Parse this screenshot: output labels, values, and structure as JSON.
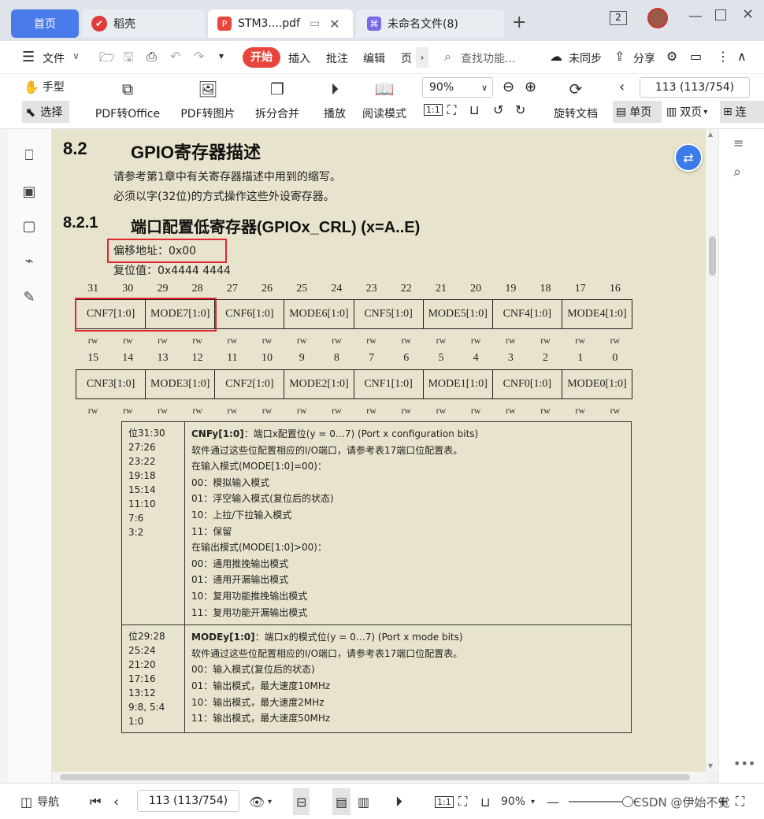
{
  "tabs": [
    {
      "label": "首页"
    },
    {
      "label": "稻壳"
    },
    {
      "label": "STM3....pdf"
    },
    {
      "label": "未命名文件(8)"
    }
  ],
  "window": {
    "badge": "2"
  },
  "menu": {
    "file": "文件",
    "start": "开始",
    "insert": "插入",
    "annotate": "批注",
    "edit": "编辑",
    "page": "页",
    "search_placeholder": "查找功能...",
    "unsynced": "未同步",
    "share": "分享"
  },
  "toolbar": {
    "hand": "手型",
    "select": "选择",
    "pdf_to_office": "PDF转Office",
    "pdf_to_image": "PDF转图片",
    "split_merge": "拆分合并",
    "play": "播放",
    "read_mode": "阅读模式",
    "zoom": "90%",
    "rotate_doc": "旋转文档",
    "page_indicator": "113 (113/754)",
    "single_page": "单页",
    "double_page": "双页",
    "continuous": "连"
  },
  "doc": {
    "section_num": "8.2",
    "section_title": "GPIO寄存器描述",
    "intro1": "请参考第1章中有关寄存器描述中用到的缩写。",
    "intro2": "必须以字(32位)的方式操作这些外设寄存器。",
    "sub_num": "8.2.1",
    "sub_title": "端口配置低寄存器(GPIOx_CRL) (x=A..E)",
    "offset": "偏移地址：0x00",
    "reset": "复位值：0x4444 4444",
    "bits_high": [
      "31",
      "30",
      "29",
      "28",
      "27",
      "26",
      "25",
      "24",
      "23",
      "22",
      "21",
      "20",
      "19",
      "18",
      "17",
      "16"
    ],
    "fields_high": [
      "CNF7[1:0]",
      "MODE7[1:0]",
      "CNF6[1:0]",
      "MODE6[1:0]",
      "CNF5[1:0]",
      "MODE5[1:0]",
      "CNF4[1:0]",
      "MODE4[1:0]"
    ],
    "bits_low": [
      "15",
      "14",
      "13",
      "12",
      "11",
      "10",
      "9",
      "8",
      "7",
      "6",
      "5",
      "4",
      "3",
      "2",
      "1",
      "0"
    ],
    "fields_low": [
      "CNF3[1:0]",
      "MODE3[1:0]",
      "CNF2[1:0]",
      "MODE2[1:0]",
      "CNF1[1:0]",
      "MODE1[1:0]",
      "CNF0[1:0]",
      "MODE0[1:0]"
    ],
    "access": "rw",
    "desc": [
      {
        "bits": [
          "位31:30",
          "27:26",
          "23:22",
          "19:18",
          "15:14",
          "11:10",
          "7:6",
          "3:2"
        ],
        "title": "CNFy[1:0]",
        "lines": [
          "：端口x配置位(y = 0…7) (Port x configuration bits)",
          "软件通过这些位配置相应的I/O端口，请参考表17端口位配置表。",
          "在输入模式(MODE[1:0]=00)：",
          "00：模拟输入模式",
          "01：浮空输入模式(复位后的状态)",
          "10：上拉/下拉输入模式",
          "11：保留",
          "在输出模式(MODE[1:0]>00)：",
          "00：通用推挽输出模式",
          "01：通用开漏输出模式",
          "10：复用功能推挽输出模式",
          "11：复用功能开漏输出模式"
        ]
      },
      {
        "bits": [
          "位29:28",
          "25:24",
          "21:20",
          "17:16",
          "13:12",
          "9:8, 5:4",
          "1:0"
        ],
        "title": "MODEy[1:0]",
        "lines": [
          "：端口x的模式位(y = 0…7) (Port x mode bits)",
          "软件通过这些位配置相应的I/O端口，请参考表17端口位配置表。",
          "00：输入模式(复位后的状态)",
          "01：输出模式，最大速度10MHz",
          "10：输出模式，最大速度2MHz",
          "11：输出模式，最大速度50MHz"
        ]
      }
    ]
  },
  "status": {
    "nav": "导航",
    "page_indicator": "113 (113/754)",
    "zoom": "90%",
    "watermark": "CSDN @伊始不觉"
  }
}
